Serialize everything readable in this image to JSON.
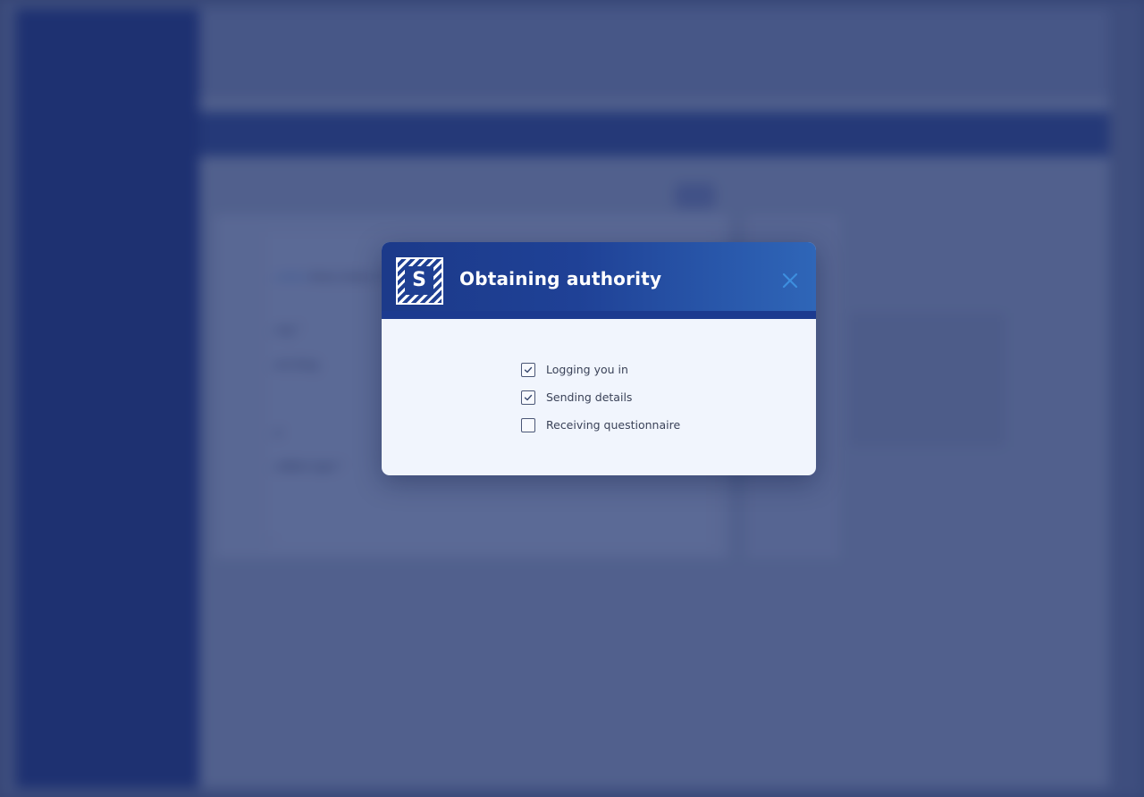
{
  "background": {
    "app_title": "",
    "breadcrumb_link": "...ookes",
    "breadcrumb_path": "Anna Jones / C",
    "field_drug_label": "...rug *",
    "field_drug_value": "...ect drug",
    "field_e_label": "...e",
    "field_condition_label": "...ndition type *",
    "field_bottom_label": "..."
  },
  "modal": {
    "logo_letter": "S",
    "title": "Obtaining authority",
    "close_icon": "close-icon",
    "steps": [
      {
        "label": "Logging you in",
        "checked": true
      },
      {
        "label": "Sending details",
        "checked": true
      },
      {
        "label": "Receiving questionnaire",
        "checked": false
      }
    ]
  },
  "colors": {
    "header_start": "#1c3a8a",
    "header_end": "#2f66b8",
    "close_icon": "#3d8ede",
    "modal_body": "#f1f5fd",
    "overlay": "#1c2d69"
  }
}
